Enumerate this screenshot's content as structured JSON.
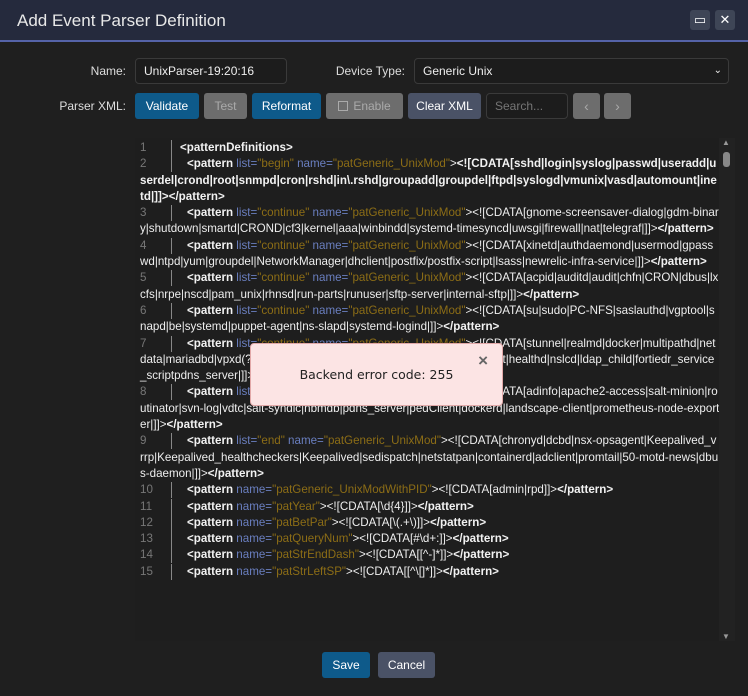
{
  "dialog": {
    "title": "Add Event Parser Definition",
    "maximize_icon": "▭",
    "close_icon": "✕"
  },
  "form": {
    "name_label": "Name:",
    "name_value": "UnixParser-19:20:16",
    "device_label": "Device Type:",
    "device_value": "Generic Unix",
    "xml_label": "Parser XML:"
  },
  "toolbar": {
    "validate": "Validate",
    "test": "Test",
    "reformat": "Reformat",
    "enable": "Enable",
    "clear": "Clear XML",
    "search_placeholder": "Search...",
    "prev": "‹",
    "next": "›"
  },
  "code_lines": [
    {
      "n": "1",
      "indent": "",
      "tokens": [
        [
          "t",
          "<patternDefinitions>"
        ]
      ]
    },
    {
      "n": "2",
      "indent": "  ",
      "tokens": [
        [
          "t",
          "<pattern "
        ],
        [
          "a",
          "list="
        ],
        [
          "v",
          "\"begin\" "
        ],
        [
          "a",
          "name="
        ],
        [
          "v",
          "\"patGeneric_UnixMod\""
        ],
        [
          "x",
          ">"
        ],
        [
          "t",
          "<![CDATA[sshd|login|syslog|passwd|useradd|userdel|crond|root|snmpd|cron|rshd|in\\.rshd|groupadd|groupdel|ftpd|syslogd|vmunix|vasd|automount|inetd|]]>"
        ],
        [
          "t",
          "</pattern>"
        ]
      ]
    },
    {
      "n": "3",
      "indent": "  ",
      "tokens": [
        [
          "t",
          "<pattern "
        ],
        [
          "a",
          "list="
        ],
        [
          "v",
          "\"continue\" "
        ],
        [
          "a",
          "name="
        ],
        [
          "v",
          "\"patGeneric_UnixMod\""
        ],
        [
          "x",
          "><![CDATA[gnome-screensaver-dialog|gdm-binary|shutdown|smartd|CROND|cf3|kernel|aaa|winbindd|systemd-timesyncd|uwsgi|firewall|nat|telegraf|]]>"
        ],
        [
          "t",
          "</pattern>"
        ]
      ]
    },
    {
      "n": "4",
      "indent": "  ",
      "tokens": [
        [
          "t",
          "<pattern "
        ],
        [
          "a",
          "list="
        ],
        [
          "v",
          "\"continue\" "
        ],
        [
          "a",
          "name="
        ],
        [
          "v",
          "\"patGeneric_UnixMod\""
        ],
        [
          "x",
          "><![CDATA[xinetd|authdaemond|usermod|gpasswd|ntpd|yum|groupdel|NetworkManager|dhclient|postfix/postfix-script|lsass|newrelic-infra-service|]]>"
        ],
        [
          "t",
          "</pattern>"
        ]
      ]
    },
    {
      "n": "5",
      "indent": "  ",
      "tokens": [
        [
          "t",
          "<pattern "
        ],
        [
          "a",
          "list="
        ],
        [
          "v",
          "\"continue\" "
        ],
        [
          "a",
          "name="
        ],
        [
          "v",
          "\"patGeneric_UnixMod\""
        ],
        [
          "x",
          "><![CDATA[acpid|auditd|audit|chfn|CRON|dbus|lxcfs|nrpe|nscd|pam_unix|rhnsd|run-parts|runuser|sftp-server|internal-sftp|]]>"
        ],
        [
          "t",
          "</pattern>"
        ]
      ]
    },
    {
      "n": "6",
      "indent": "  ",
      "tokens": [
        [
          "t",
          "<pattern "
        ],
        [
          "a",
          "list="
        ],
        [
          "v",
          "\"continue\" "
        ],
        [
          "a",
          "name="
        ],
        [
          "v",
          "\"patGeneric_UnixMod\""
        ],
        [
          "x",
          "><![CDATA[su|sudo|PC-NFS|saslauthd|vgptool|snapd|be|systemd|puppet-agent|ns-slapd|systemd-logind|]]>"
        ],
        [
          "t",
          "</pattern>"
        ]
      ]
    },
    {
      "n": "7",
      "indent": "  ",
      "tokens": [
        [
          "t",
          "<pattern "
        ],
        [
          "a",
          "list="
        ],
        [
          "v",
          "\"continue\" "
        ],
        [
          "a",
          "name="
        ],
        [
          "v",
          "\"patGeneric_UnixMod\""
        ],
        [
          "x",
          "><![CDATA[stunnel|realmd|docker|multipathd|netdata|mariadbd|vpxd(?:[-_]\\w+)?|fctsched|pdns-recursor|python3|filebeat|healthd|nslcd|ldap_child|fortiedr_service_scriptpdns_server|]]>"
        ],
        [
          "t",
          "</pattern>"
        ]
      ]
    },
    {
      "n": "8",
      "indent": "  ",
      "tokens": [
        [
          "t",
          "<pattern "
        ],
        [
          "a",
          "list="
        ],
        [
          "v",
          "\"continue\" "
        ],
        [
          "a",
          "name="
        ],
        [
          "v",
          "\"patGeneric_UnixMod\""
        ],
        [
          "x",
          "><![CDATA[adinfo|apache2-access|salt-minion|routinator|svn-log|vdtc|salt-syndic|nbmdb|pdns_server|pedClient|dockerd|landscape-client|prometheus-node-exporter|]]>"
        ],
        [
          "t",
          "</pattern>"
        ]
      ]
    },
    {
      "n": "9",
      "indent": "  ",
      "tokens": [
        [
          "t",
          "<pattern "
        ],
        [
          "a",
          "list="
        ],
        [
          "v",
          "\"end\" "
        ],
        [
          "a",
          "name="
        ],
        [
          "v",
          "\"patGeneric_UnixMod\""
        ],
        [
          "x",
          "><![CDATA[chronyd|dcbd|nsx-opsagent|Keepalived_vrrp|Keepalived_healthcheckers|Keepalived|sedispatch|netstatpan|containerd|adclient|promtail|50-motd-news|dbus-daemon|]]>"
        ],
        [
          "t",
          "</pattern>"
        ]
      ]
    },
    {
      "n": "10",
      "indent": "  ",
      "tokens": [
        [
          "t",
          "<pattern "
        ],
        [
          "a",
          "name="
        ],
        [
          "v",
          "\"patGeneric_UnixModWithPID\""
        ],
        [
          "x",
          "><![CDATA[admin|rpd]]>"
        ],
        [
          "t",
          "</pattern>"
        ]
      ]
    },
    {
      "n": "11",
      "indent": "  ",
      "tokens": [
        [
          "t",
          "<pattern "
        ],
        [
          "a",
          "name="
        ],
        [
          "v",
          "\"patYear\""
        ],
        [
          "x",
          "><![CDATA[\\d{4}]]>"
        ],
        [
          "t",
          "</pattern>"
        ]
      ]
    },
    {
      "n": "12",
      "indent": "  ",
      "tokens": [
        [
          "t",
          "<pattern "
        ],
        [
          "a",
          "name="
        ],
        [
          "v",
          "\"patBetPar\""
        ],
        [
          "x",
          "><![CDATA[\\(.+\\)]]>"
        ],
        [
          "t",
          "</pattern>"
        ]
      ]
    },
    {
      "n": "13",
      "indent": "  ",
      "tokens": [
        [
          "t",
          "<pattern "
        ],
        [
          "a",
          "name="
        ],
        [
          "v",
          "\"patQueryNum\""
        ],
        [
          "x",
          "><![CDATA[#\\d+:]]>"
        ],
        [
          "t",
          "</pattern>"
        ]
      ]
    },
    {
      "n": "14",
      "indent": "  ",
      "tokens": [
        [
          "t",
          "<pattern "
        ],
        [
          "a",
          "name="
        ],
        [
          "v",
          "\"patStrEndDash\""
        ],
        [
          "x",
          "><![CDATA[[^-]*]]>"
        ],
        [
          "t",
          "</pattern>"
        ]
      ]
    },
    {
      "n": "15",
      "indent": "  ",
      "tokens": [
        [
          "t",
          "<pattern "
        ],
        [
          "a",
          "name="
        ],
        [
          "v",
          "\"patStrLeftSP\""
        ],
        [
          "x",
          "><![CDATA[[^\\[]*]]>"
        ],
        [
          "t",
          "</pattern>"
        ]
      ]
    }
  ],
  "error_popup": {
    "message": "Backend error code: 255",
    "close_icon": "×"
  },
  "footer": {
    "save": "Save",
    "cancel": "Cancel"
  }
}
